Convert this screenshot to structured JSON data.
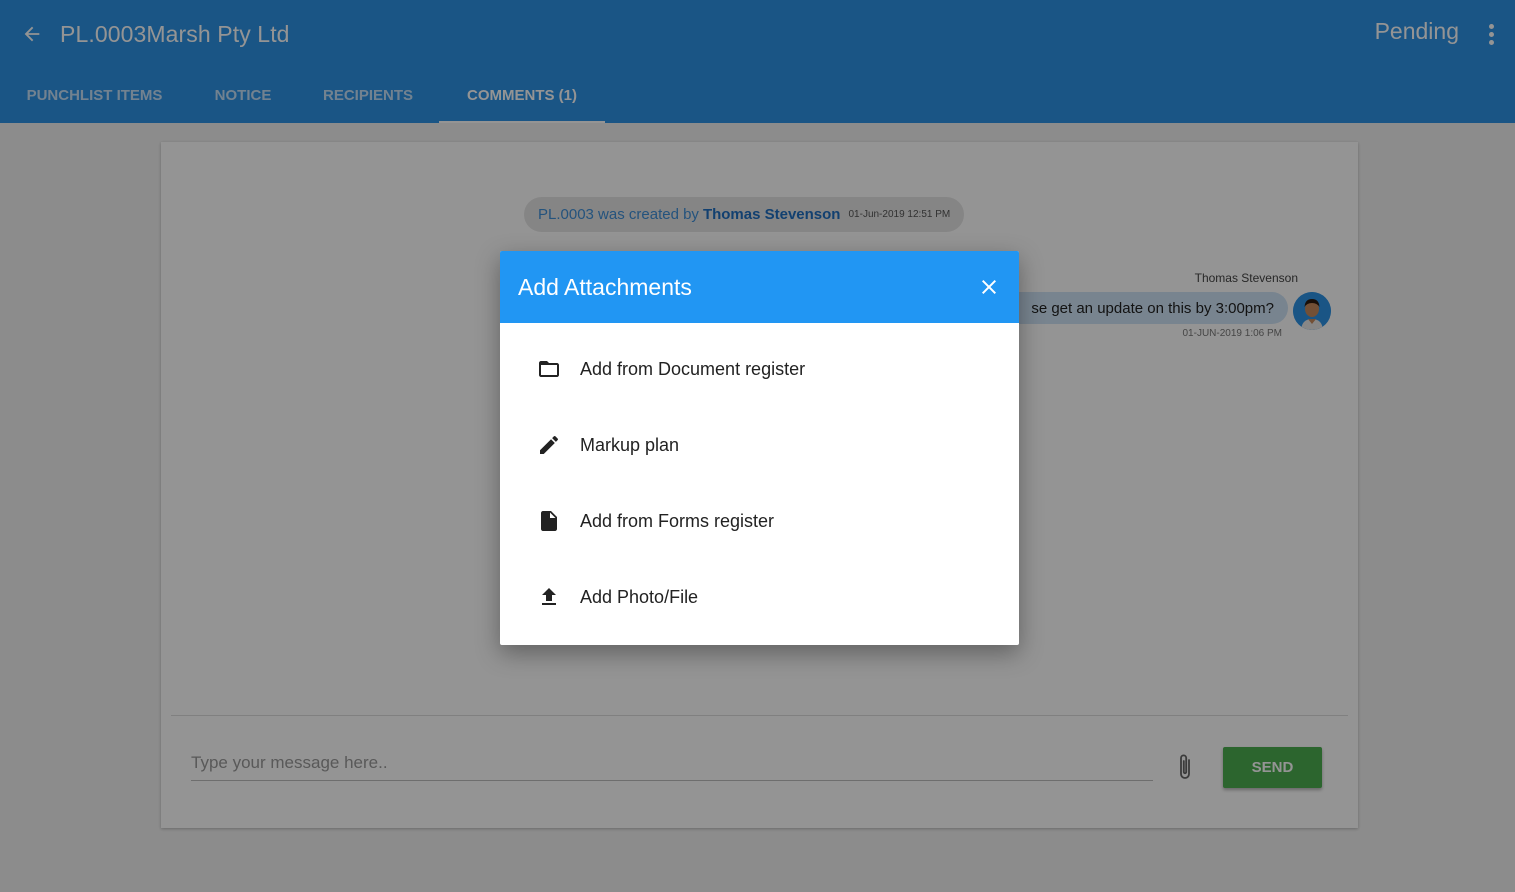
{
  "header": {
    "title": "PL.0003Marsh Pty Ltd",
    "status": "Pending",
    "icons": {
      "back": "arrow-left-icon",
      "more": "more-vert-icon"
    }
  },
  "tabs": [
    {
      "label": "PUNCHLIST ITEMS",
      "active": false
    },
    {
      "label": "NOTICE",
      "active": false
    },
    {
      "label": "RECIPIENTS",
      "active": false
    },
    {
      "label": "COMMENTS (1)",
      "active": true
    }
  ],
  "comments": {
    "system_message": {
      "text": "PL.0003 was created by",
      "author": "Thomas Stevenson",
      "timestamp": "01-Jun-2019 12:51 PM"
    },
    "message": {
      "sender": "Thomas Stevenson",
      "text": "se get an update on this by 3:00pm?",
      "timestamp": "01-JUN-2019 1:06 PM"
    },
    "composer": {
      "placeholder": "Type your message here..",
      "send_label": "SEND"
    }
  },
  "dialog": {
    "title": "Add Attachments",
    "options": [
      {
        "label": "Add from Document register",
        "icon": "folder-icon"
      },
      {
        "label": "Markup plan",
        "icon": "pencil-icon"
      },
      {
        "label": "Add from Forms register",
        "icon": "file-icon"
      },
      {
        "label": "Add Photo/File",
        "icon": "upload-icon"
      }
    ]
  },
  "colors": {
    "appbar": "#2e93e6",
    "dialog_header": "#2196f3",
    "send_button": "#4caf50",
    "link": "#1f6fc1"
  }
}
